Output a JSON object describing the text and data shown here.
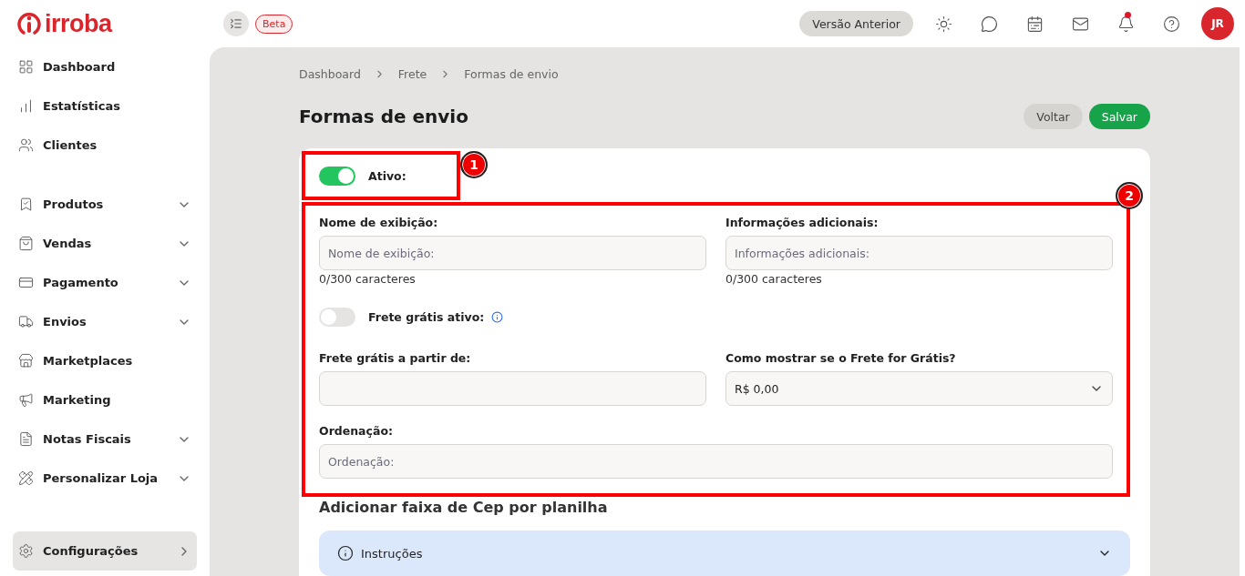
{
  "brand": {
    "name": "irroba"
  },
  "topbar": {
    "beta": "Beta",
    "previous_version": "Versão Anterior",
    "notification_dot": true,
    "avatar": "JR"
  },
  "sidebar": {
    "groups": [
      [
        {
          "label": "Dashboard",
          "kind": "plain",
          "selected": false
        },
        {
          "label": "Estatísticas",
          "kind": "plain",
          "selected": false
        },
        {
          "label": "Clientes",
          "kind": "plain",
          "selected": false
        }
      ],
      [
        {
          "label": "Produtos",
          "kind": "expand",
          "selected": false
        },
        {
          "label": "Vendas",
          "kind": "expand",
          "selected": false
        },
        {
          "label": "Pagamento",
          "kind": "expand",
          "selected": false
        },
        {
          "label": "Envios",
          "kind": "expand",
          "selected": false
        },
        {
          "label": "Marketplaces",
          "kind": "plain",
          "selected": false
        },
        {
          "label": "Marketing",
          "kind": "plain",
          "selected": false
        },
        {
          "label": "Notas Fiscais",
          "kind": "expand",
          "selected": false
        },
        {
          "label": "Personalizar Loja",
          "kind": "expand",
          "selected": false
        }
      ],
      [
        {
          "label": "Configurações",
          "kind": "link",
          "selected": true
        }
      ]
    ]
  },
  "breadcrumb": [
    "Dashboard",
    "Frete",
    "Formas de envio"
  ],
  "page_title": "Formas de envio",
  "actions": [
    {
      "label": "Voltar",
      "kind": "secondary"
    },
    {
      "label": "Salvar",
      "kind": "primary"
    }
  ],
  "status": {
    "label": "Ativo:",
    "on": true,
    "marker": "1"
  },
  "form": {
    "marker": "2",
    "fields": [
      {
        "label": "Nome de exibição:",
        "placeholder": "Nome de exibição:",
        "counter": "0/300 caracteres"
      },
      {
        "label": "Informações adicionais:",
        "placeholder": "Informações adicionais:",
        "counter": "0/300 caracteres"
      }
    ],
    "free_shipping": {
      "label": "Frete grátis ativo:",
      "on": false
    },
    "fields2": [
      {
        "label": "Frete grátis a partir de:",
        "kind": "text"
      },
      {
        "label": "Como mostrar se o Frete for Grátis?",
        "value": "R$ 0,00",
        "kind": "select"
      }
    ],
    "order": {
      "label": "Ordenação:",
      "placeholder": "Ordenação:"
    }
  },
  "section_title": "Adicionar faixa de Cep por planilha",
  "accordion": {
    "label": "Instruções",
    "expanded": false
  }
}
